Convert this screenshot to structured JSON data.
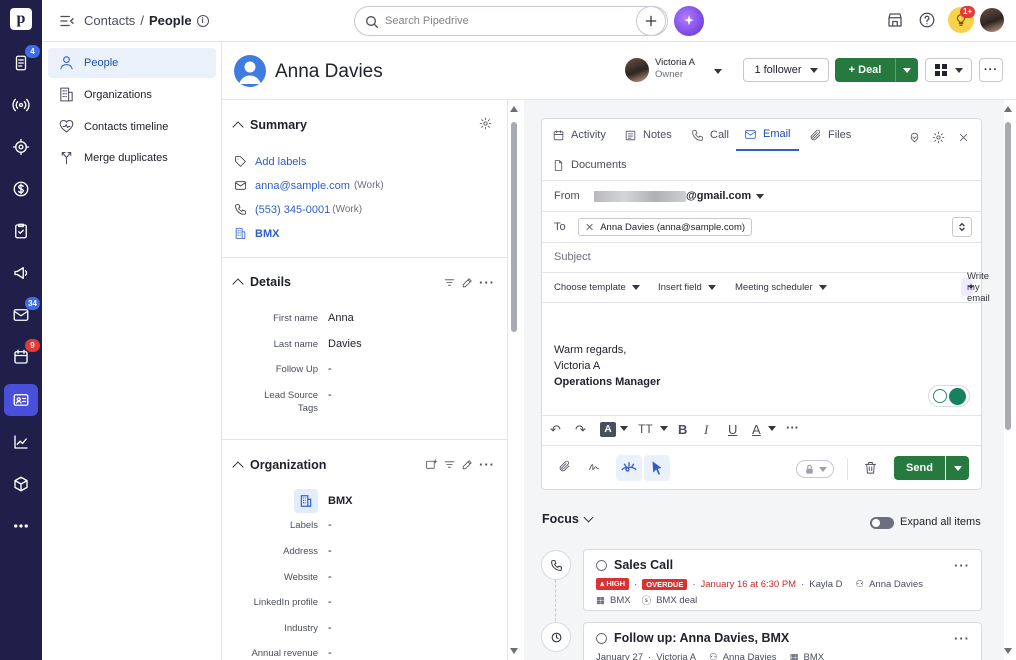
{
  "app": {
    "logo_letter": "p"
  },
  "rail": {
    "badges": {
      "products": "4",
      "mail": "34",
      "activities": "9"
    }
  },
  "topbar": {
    "breadcrumb_parent": "Contacts",
    "breadcrumb_sep": "/",
    "breadcrumb_current": "People",
    "search_placeholder": "Search Pipedrive",
    "notifications_badge": "1+"
  },
  "subnav": {
    "items": [
      {
        "label": "People",
        "active": true
      },
      {
        "label": "Organizations"
      },
      {
        "label": "Contacts timeline"
      },
      {
        "label": "Merge duplicates"
      }
    ]
  },
  "person": {
    "name": "Anna Davies",
    "owner_name": "Victoria A",
    "owner_role": "Owner",
    "follower_label": "1 follower",
    "deal_label": "+ Deal"
  },
  "summary": {
    "title": "Summary",
    "add_labels": "Add labels",
    "email": "anna@sample.com",
    "email_type": "(Work)",
    "phone": "(553) 345-0001",
    "phone_type": "(Work)",
    "org": "BMX"
  },
  "details": {
    "title": "Details",
    "fields": [
      {
        "label": "First name",
        "value": "Anna"
      },
      {
        "label": "Last name",
        "value": "Davies"
      },
      {
        "label": "Follow Up",
        "value": "-"
      },
      {
        "label": "Lead Source Tags",
        "value": "-"
      }
    ]
  },
  "organization": {
    "title": "Organization",
    "name": "BMX",
    "fields": [
      {
        "label": "Labels",
        "value": "-"
      },
      {
        "label": "Address",
        "value": "-"
      },
      {
        "label": "Website",
        "value": "-"
      },
      {
        "label": "LinkedIn profile",
        "value": "-"
      },
      {
        "label": "Industry",
        "value": "-"
      },
      {
        "label": "Annual revenue",
        "value": "-"
      }
    ]
  },
  "composer": {
    "tabs": [
      "Activity",
      "Notes",
      "Call",
      "Email",
      "Files",
      "Documents"
    ],
    "from_label": "From",
    "from_value": "@gmail.com",
    "to_label": "To",
    "to_chip": "Anna Davies (anna@sample.com)",
    "subject_placeholder": "Subject",
    "choose_template": "Choose template",
    "insert_field": "Insert field",
    "meeting_scheduler": "Meeting scheduler",
    "write_my_email": "Write my email",
    "signature": [
      "Warm regards,",
      "Victoria A",
      "Operations Manager"
    ],
    "send_label": "Send"
  },
  "focus": {
    "title": "Focus",
    "expand_label": "Expand all items",
    "cards": [
      {
        "title": "Sales Call",
        "priority": "HIGH",
        "status": "OVERDUE",
        "due": "January 16 at 6:30 PM",
        "assignee": "Kayla D",
        "person": "Anna Davies",
        "org": "BMX",
        "deal": "BMX deal"
      },
      {
        "title": "Follow up: Anna Davies, BMX",
        "due": "January 27",
        "assignee": "Victoria A",
        "person": "Anna Davies",
        "org": "BMX"
      }
    ]
  },
  "colors": {
    "rail": "#1f1f4a",
    "accent": "#2f5ec9",
    "green": "#26793f",
    "overdue": "#d93232"
  }
}
